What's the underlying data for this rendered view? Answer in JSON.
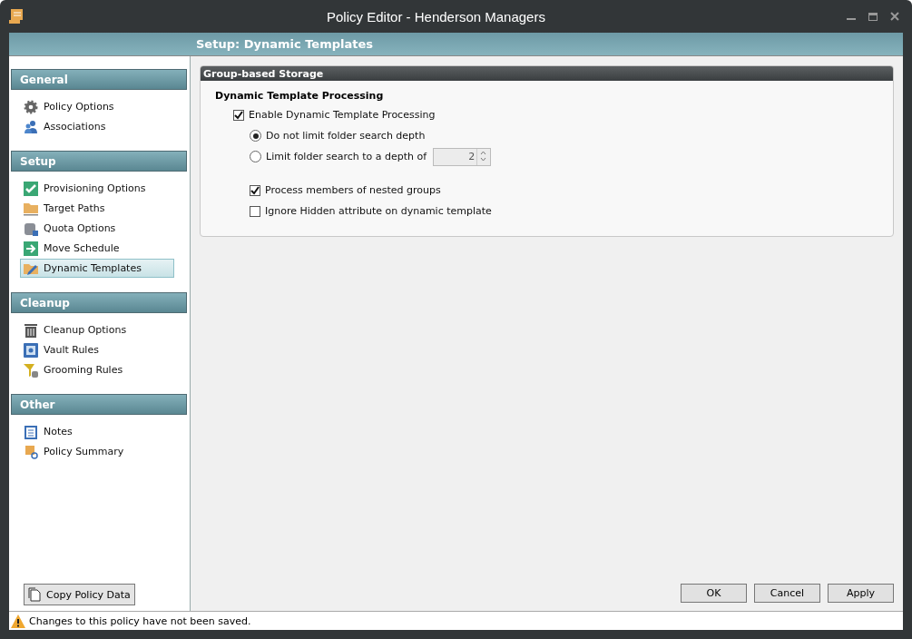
{
  "window": {
    "title": "Policy Editor - Henderson Managers"
  },
  "header": {
    "title": "Setup: Dynamic Templates"
  },
  "sidebar": {
    "sections": [
      {
        "title": "General",
        "items": [
          {
            "label": "Policy Options",
            "selected": false
          },
          {
            "label": "Associations",
            "selected": false
          }
        ]
      },
      {
        "title": "Setup",
        "items": [
          {
            "label": "Provisioning Options",
            "selected": false
          },
          {
            "label": "Target Paths",
            "selected": false
          },
          {
            "label": "Quota Options",
            "selected": false
          },
          {
            "label": "Move Schedule",
            "selected": false
          },
          {
            "label": "Dynamic Templates",
            "selected": true
          }
        ]
      },
      {
        "title": "Cleanup",
        "items": [
          {
            "label": "Cleanup Options",
            "selected": false
          },
          {
            "label": "Vault Rules",
            "selected": false
          },
          {
            "label": "Grooming Rules",
            "selected": false
          }
        ]
      },
      {
        "title": "Other",
        "items": [
          {
            "label": "Notes",
            "selected": false
          },
          {
            "label": "Policy Summary",
            "selected": false
          }
        ]
      }
    ],
    "copy_button": "Copy Policy Data"
  },
  "panel": {
    "title": "Group-based Storage",
    "section_title": "Dynamic Template Processing",
    "enable": {
      "label": "Enable Dynamic Template Processing",
      "checked": true
    },
    "radios": [
      {
        "label": "Do not limit folder search depth",
        "selected": true
      },
      {
        "label": "Limit folder search to a depth of",
        "selected": false,
        "value": "2"
      }
    ],
    "options": [
      {
        "label": "Process members of nested groups",
        "checked": true
      },
      {
        "label": "Ignore Hidden attribute on dynamic template",
        "checked": false
      }
    ]
  },
  "buttons": [
    "OK",
    "Cancel",
    "Apply"
  ],
  "status_bar": {
    "message": "Changes to this policy have not been saved."
  }
}
